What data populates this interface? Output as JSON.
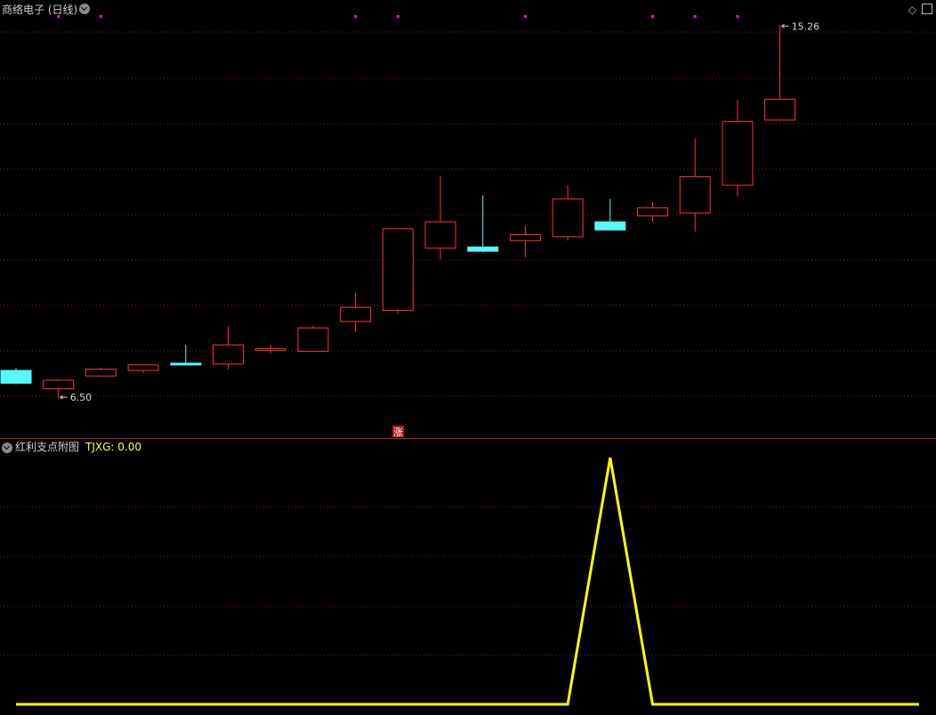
{
  "main_panel": {
    "title": "商络电子 (日线)",
    "high_marker": "15.26",
    "low_marker": "6.50",
    "zhang_label": "涨"
  },
  "sub_panel": {
    "title": "红利支点附图",
    "indicator_label": "TJXG: 0.00"
  },
  "colors": {
    "up": "#ff3232",
    "down": "#54fcfc",
    "grid": "#8b1a1a",
    "signal_dot": "#ff00ff",
    "indicator": "#ffff00"
  },
  "chart_data": [
    {
      "type": "candlestick",
      "title": "商络电子 (日线)",
      "ylim": [
        6.0,
        15.6
      ],
      "annotations": [
        {
          "text": "15.26",
          "value": 15.26,
          "candle": 18
        },
        {
          "text": "6.50",
          "value": 6.5,
          "candle": 1
        }
      ],
      "signal_dots": [
        1,
        2,
        8,
        9,
        12,
        15,
        16,
        17
      ],
      "candles": [
        {
          "open": 7.15,
          "close": 6.85,
          "high": 7.2,
          "low": 6.82
        },
        {
          "open": 6.72,
          "close": 6.92,
          "high": 6.95,
          "low": 6.5
        },
        {
          "open": 7.02,
          "close": 7.18,
          "high": 7.21,
          "low": 7.0
        },
        {
          "open": 7.15,
          "close": 7.28,
          "high": 7.3,
          "low": 7.1
        },
        {
          "open": 7.32,
          "close": 7.3,
          "high": 7.75,
          "low": 7.28
        },
        {
          "open": 7.3,
          "close": 7.75,
          "high": 8.18,
          "low": 7.18
        },
        {
          "open": 7.65,
          "close": 7.66,
          "high": 7.75,
          "low": 7.55
        },
        {
          "open": 7.6,
          "close": 8.15,
          "high": 8.2,
          "low": 7.6
        },
        {
          "open": 8.3,
          "close": 8.63,
          "high": 8.97,
          "low": 8.05
        },
        {
          "open": 8.56,
          "close": 10.48,
          "high": 10.48,
          "low": 8.48
        },
        {
          "open": 10.02,
          "close": 10.64,
          "high": 11.72,
          "low": 9.76
        },
        {
          "open": 10.05,
          "close": 9.95,
          "high": 11.26,
          "low": 9.93
        },
        {
          "open": 10.2,
          "close": 10.34,
          "high": 10.55,
          "low": 9.8
        },
        {
          "open": 10.29,
          "close": 11.18,
          "high": 11.5,
          "low": 10.2
        },
        {
          "open": 10.64,
          "close": 10.45,
          "high": 11.18,
          "low": 10.45
        },
        {
          "open": 10.78,
          "close": 10.97,
          "high": 11.1,
          "low": 10.64
        },
        {
          "open": 10.85,
          "close": 11.7,
          "high": 12.6,
          "low": 10.41
        },
        {
          "open": 11.5,
          "close": 13.0,
          "high": 13.5,
          "low": 11.25
        },
        {
          "open": 13.03,
          "close": 13.52,
          "high": 15.26,
          "low": 13.03
        }
      ]
    },
    {
      "type": "line",
      "title": "红利支点附图",
      "series": [
        {
          "name": "TJXG",
          "values": [
            0,
            0,
            0,
            0,
            0,
            0,
            0,
            0,
            0,
            0,
            0,
            0,
            0,
            0,
            1,
            0,
            0,
            0,
            0
          ]
        }
      ],
      "ylim": [
        0,
        1.0
      ]
    }
  ]
}
